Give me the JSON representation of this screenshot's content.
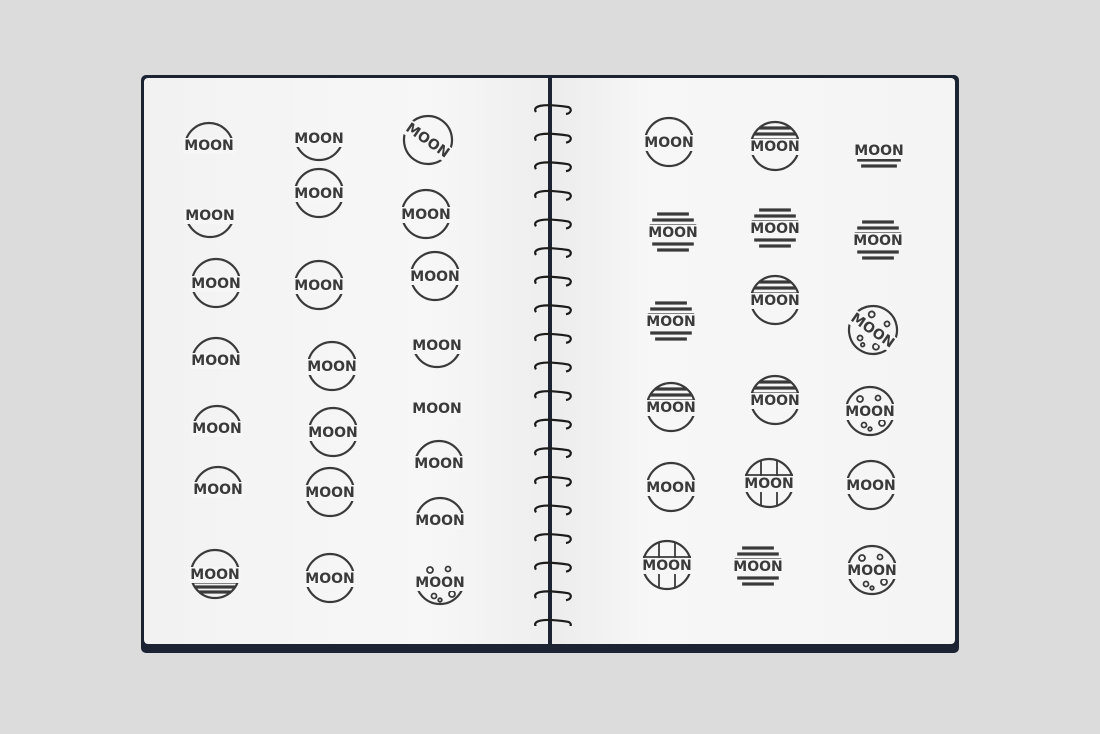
{
  "scene": "spiral notebook with logo sketches",
  "logo_word": "MOON",
  "colors": {
    "ink": "#3a3a3a",
    "paper": "#f6f6f6",
    "cover": "#1c2433",
    "background": "#dcdcdc"
  },
  "left_page": {
    "logo_count": 21
  },
  "right_page": {
    "logo_count": 18
  }
}
